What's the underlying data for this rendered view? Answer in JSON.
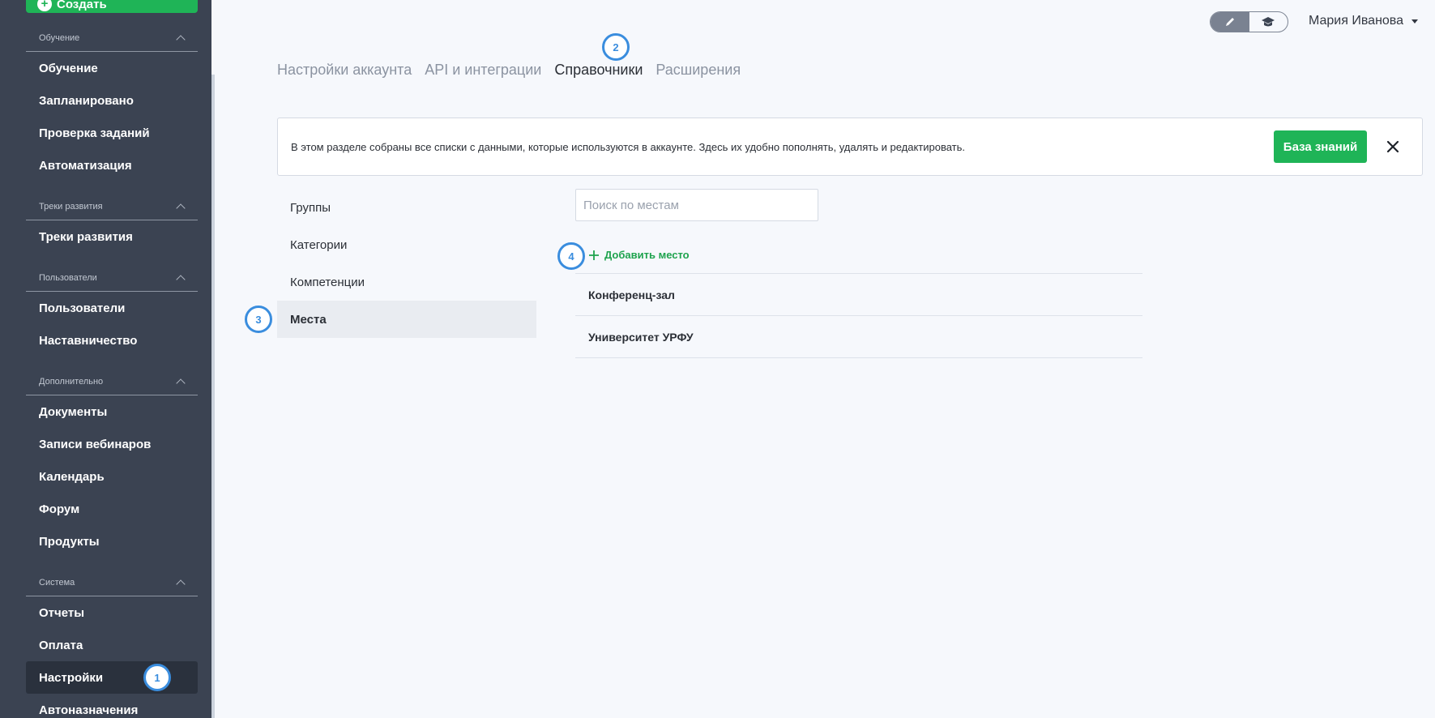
{
  "sidebar": {
    "create_label": "Создать",
    "sections": [
      {
        "title": "Обучение",
        "items": [
          "Обучение",
          "Запланировано",
          "Проверка заданий",
          "Автоматизация"
        ]
      },
      {
        "title": "Треки развития",
        "items": [
          "Треки развития"
        ]
      },
      {
        "title": "Пользователи",
        "items": [
          "Пользователи",
          "Наставничество"
        ]
      },
      {
        "title": "Дополнительно",
        "items": [
          "Документы",
          "Записи вебинаров",
          "Календарь",
          "Форум",
          "Продукты"
        ]
      },
      {
        "title": "Система",
        "items": [
          "Отчеты",
          "Оплата",
          "Настройки",
          "Автоназначения"
        ]
      }
    ],
    "active_item": "Настройки"
  },
  "markers": [
    "1",
    "2",
    "3",
    "4"
  ],
  "header": {
    "user_name": "Мария Иванова",
    "mode_icons": [
      "pencil-icon",
      "graduation-cap-icon"
    ]
  },
  "tabs": [
    {
      "label": "Настройки аккаунта",
      "active": false
    },
    {
      "label": "API и интеграции",
      "active": false
    },
    {
      "label": "Справочники",
      "active": true
    },
    {
      "label": "Расширения",
      "active": false
    }
  ],
  "banner": {
    "text": "В этом разделе собраны все списки с данными, которые используются в аккаунте. Здесь их удобно пополнять, удалять и редактировать.",
    "button_label": "База знаний"
  },
  "references": [
    {
      "label": "Группы",
      "active": false
    },
    {
      "label": "Категории",
      "active": false
    },
    {
      "label": "Компетенции",
      "active": false
    },
    {
      "label": "Места",
      "active": true
    }
  ],
  "places": {
    "search_placeholder": "Поиск по местам",
    "add_label": "Добавить место",
    "items": [
      "Конференц-зал",
      "Университет УРФУ"
    ]
  },
  "colors": {
    "accent_green": "#1fb457",
    "sidebar_bg": "#3b4352",
    "marker_blue": "#3a8dde"
  }
}
